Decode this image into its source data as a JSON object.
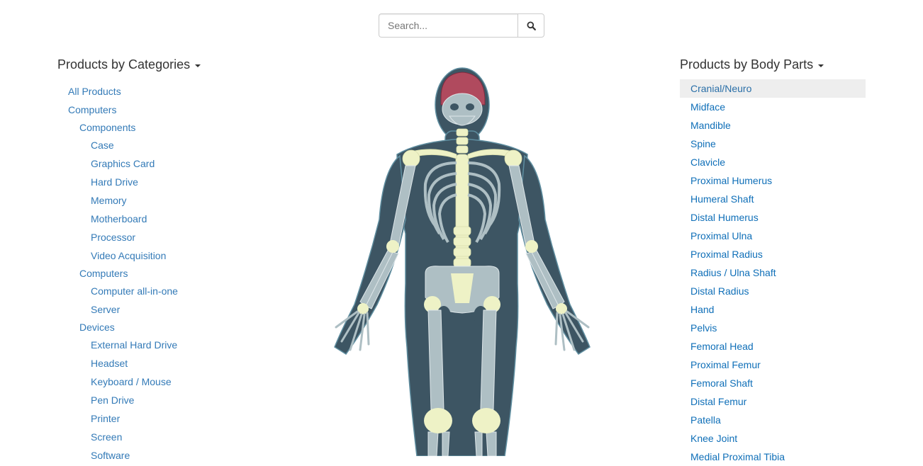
{
  "search": {
    "placeholder": "Search...",
    "button_icon": "search-icon"
  },
  "left_panel": {
    "title": "Products by Categories",
    "items": [
      {
        "label": "All Products",
        "level": 0
      },
      {
        "label": "Computers",
        "level": 0
      },
      {
        "label": "Components",
        "level": 1
      },
      {
        "label": "Case",
        "level": 2
      },
      {
        "label": "Graphics Card",
        "level": 2
      },
      {
        "label": "Hard Drive",
        "level": 2
      },
      {
        "label": "Memory",
        "level": 2
      },
      {
        "label": "Motherboard",
        "level": 2
      },
      {
        "label": "Processor",
        "level": 2
      },
      {
        "label": "Video Acquisition",
        "level": 2
      },
      {
        "label": "Computers",
        "level": 1
      },
      {
        "label": "Computer all-in-one",
        "level": 2
      },
      {
        "label": "Server",
        "level": 2
      },
      {
        "label": "Devices",
        "level": 1
      },
      {
        "label": "External Hard Drive",
        "level": 2
      },
      {
        "label": "Headset",
        "level": 2
      },
      {
        "label": "Keyboard / Mouse",
        "level": 2
      },
      {
        "label": "Pen Drive",
        "level": 2
      },
      {
        "label": "Printer",
        "level": 2
      },
      {
        "label": "Screen",
        "level": 2
      },
      {
        "label": "Software",
        "level": 2
      }
    ]
  },
  "right_panel": {
    "title": "Products by Body Parts",
    "selected": "Cranial/Neuro",
    "items": [
      "Cranial/Neuro",
      "Midface",
      "Mandible",
      "Spine",
      "Clavicle",
      "Proximal Humerus",
      "Humeral Shaft",
      "Distal Humerus",
      "Proximal Ulna",
      "Proximal Radius",
      "Radius / Ulna Shaft",
      "Distal Radius",
      "Hand",
      "Pelvis",
      "Femoral Head",
      "Proximal Femur",
      "Femoral Shaft",
      "Distal Femur",
      "Patella",
      "Knee Joint",
      "Medial Proximal Tibia"
    ]
  },
  "colors": {
    "link": "#337ab7",
    "body_part_link": "#0f6fb8",
    "selected_bg": "#eeeeee",
    "silhouette": "#3d5563",
    "bone": "#aebfc4",
    "joint": "#eef2c6",
    "highlight": "#b04a5e"
  }
}
